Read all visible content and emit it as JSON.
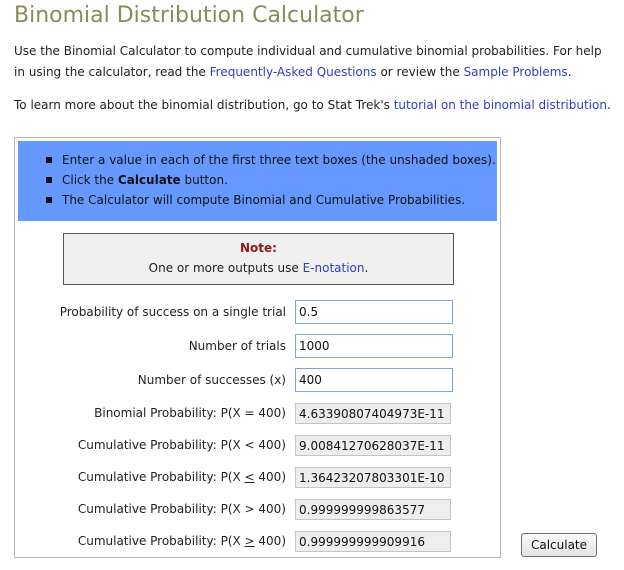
{
  "title": "Binomial Distribution Calculator",
  "intro": {
    "text1": "Use the Binomial Calculator to compute individual and cumulative binomial probabilities. For help in using the calculator, read the ",
    "faq_link": "Frequently-Asked Questions",
    "text2": " or review the ",
    "samples_link": "Sample Problems",
    "text3": "."
  },
  "learn": {
    "text1": "To learn more about the binomial distribution, go to Stat Trek's ",
    "tutorial_link": "tutorial on the binomial distribution",
    "text2": "."
  },
  "instructions": {
    "item1": "Enter a value in each of the first three text boxes (the unshaded boxes).",
    "item2_pre": "Click the ",
    "item2_bold": "Calculate",
    "item2_post": " button.",
    "item3": "The Calculator will compute Binomial and Cumulative Probabilities."
  },
  "note": {
    "title": "Note:",
    "text": "One or more outputs use ",
    "link": "E-notation",
    "end": "."
  },
  "inputs": {
    "p_label": "Probability of success on a single trial",
    "p_value": "0.5",
    "n_label": "Number of trials",
    "n_value": "1000",
    "x_label": "Number of successes (x)",
    "x_value": "400"
  },
  "outputs": {
    "eq_label": "Binomial Probability: P(X = 400)",
    "eq_value": "4.63390807404973E-11",
    "lt_label": "Cumulative Probability: P(X < 400)",
    "lt_value": "9.00841270628037E-11",
    "le_label_pre": "Cumulative Probability: P(X ",
    "le_symbol": "<",
    "le_label_post": " 400)",
    "le_value": "1.36423207803301E-10",
    "gt_label": "Cumulative Probability: P(X > 400)",
    "gt_value": "0.999999999863577",
    "ge_label_pre": "Cumulative Probability: P(X ",
    "ge_symbol": ">",
    "ge_label_post": " 400)",
    "ge_value": "0.999999999909916"
  },
  "calculate_label": "Calculate",
  "colors": {
    "title": "#8a8a5a",
    "instructions_bg": "#6699ff",
    "link": "#2f3fbf",
    "note_title": "#8b1a1a"
  }
}
